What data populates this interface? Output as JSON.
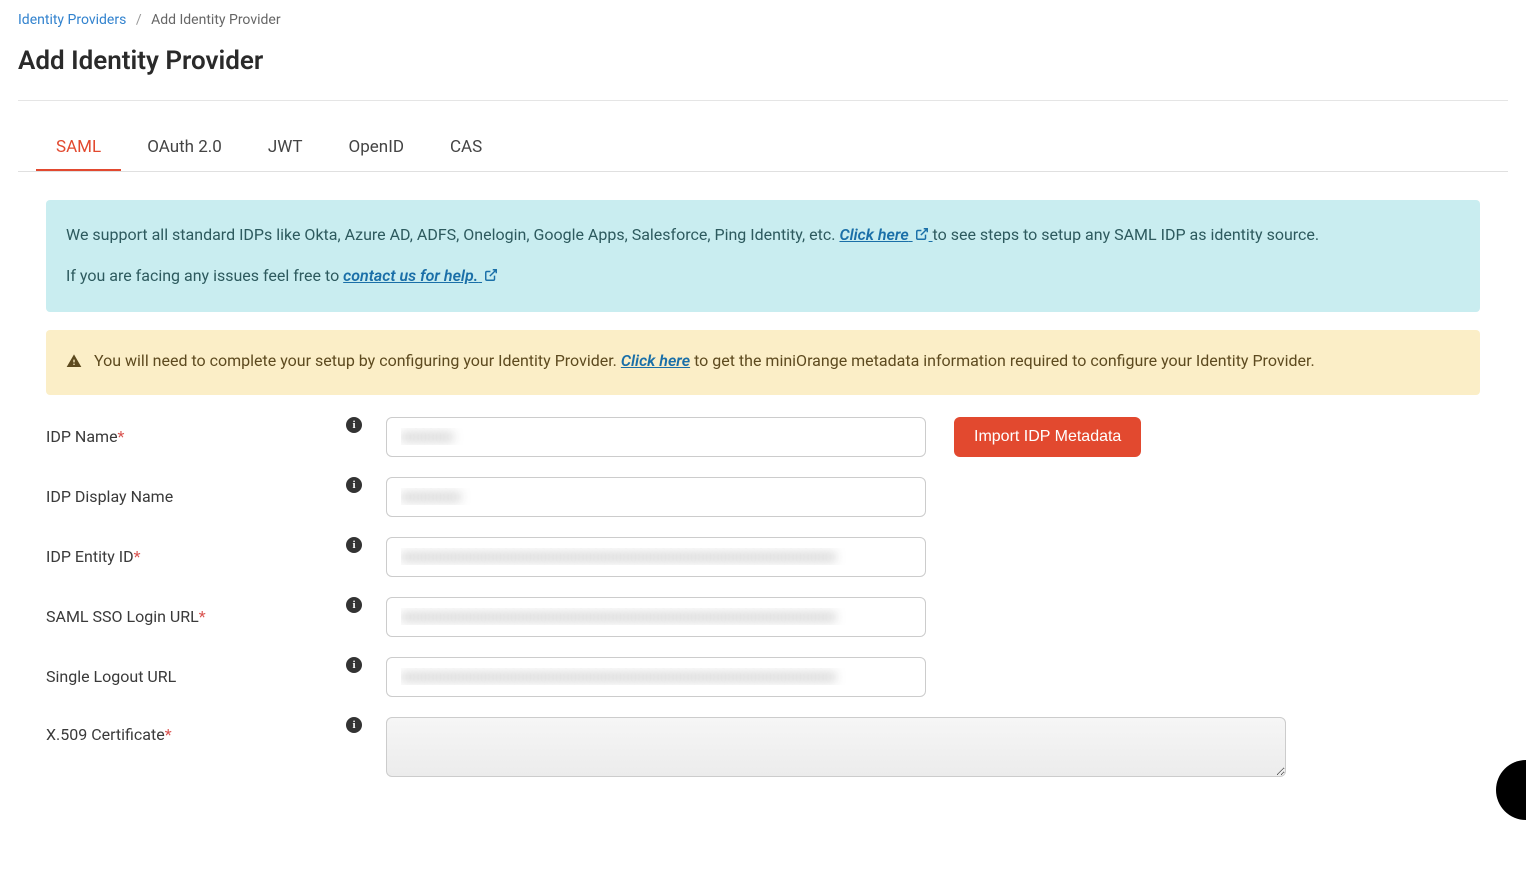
{
  "breadcrumb": {
    "parent": "Identity Providers",
    "separator": "/",
    "current": "Add Identity Provider"
  },
  "page_title": "Add Identity Provider",
  "tabs": [
    {
      "label": "SAML",
      "active": true
    },
    {
      "label": "OAuth 2.0",
      "active": false
    },
    {
      "label": "JWT",
      "active": false
    },
    {
      "label": "OpenID",
      "active": false
    },
    {
      "label": "CAS",
      "active": false
    }
  ],
  "info_box": {
    "line1_pre": "We support all standard IDPs like Okta, Azure AD, ADFS, Onelogin, Google Apps, Salesforce, Ping Identity, etc. ",
    "click_here": "Click here",
    "line1_post": " to see steps to setup any SAML IDP as identity source.",
    "line2_pre": "If you are facing any issues feel free to ",
    "contact_us": "contact us for help."
  },
  "warn_box": {
    "pre": "You will need to complete your setup by configuring your Identity Provider. ",
    "click_here": "Click here",
    "post": " to get the miniOrange metadata information required to configure your Identity Provider."
  },
  "buttons": {
    "import_metadata": "Import IDP Metadata"
  },
  "form": {
    "idp_name": {
      "label": "IDP Name",
      "required": true,
      "value": ""
    },
    "idp_display_name": {
      "label": "IDP Display Name",
      "required": false,
      "value": ""
    },
    "idp_entity_id": {
      "label": "IDP Entity ID",
      "required": true,
      "value": ""
    },
    "saml_sso_login_url": {
      "label": "SAML SSO Login URL",
      "required": true,
      "value": ""
    },
    "single_logout_url": {
      "label": "Single Logout URL",
      "required": false,
      "value": ""
    },
    "x509_certificate": {
      "label": "X.509 Certificate",
      "required": true,
      "value": ""
    }
  }
}
